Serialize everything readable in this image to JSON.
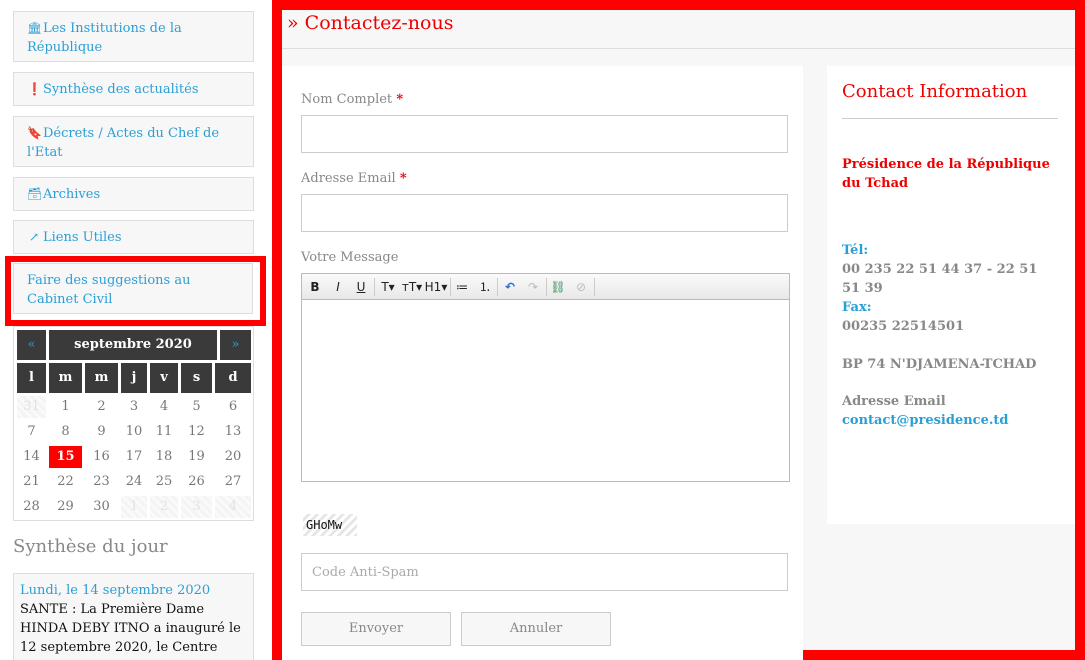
{
  "sidebar": {
    "nav": [
      {
        "icon": "institution-icon",
        "label": "Les Institutions de la République"
      },
      {
        "icon": "exclamation-circle-icon",
        "label": "Synthèse des actualités"
      },
      {
        "icon": "bookmark-icon",
        "label": "Décrets / Actes du Chef de l'Etat"
      },
      {
        "icon": "archive-icon",
        "label": "Archives"
      },
      {
        "icon": "external-link-icon",
        "label": "Liens Utiles"
      },
      {
        "icon": "",
        "label": "Faire des suggestions au Cabinet Civil"
      }
    ],
    "calendar": {
      "prev": "«",
      "next": "»",
      "title": "septembre 2020",
      "weekdays": [
        "l",
        "m",
        "m",
        "j",
        "v",
        "s",
        "d"
      ],
      "weeks": [
        [
          "31",
          "1",
          "2",
          "3",
          "4",
          "5",
          "6"
        ],
        [
          "7",
          "8",
          "9",
          "10",
          "11",
          "12",
          "13"
        ],
        [
          "14",
          "15",
          "16",
          "17",
          "18",
          "19",
          "20"
        ],
        [
          "21",
          "22",
          "23",
          "24",
          "25",
          "26",
          "27"
        ],
        [
          "28",
          "29",
          "30",
          "1",
          "2",
          "3",
          "4"
        ]
      ],
      "today": "15"
    },
    "synthese": {
      "title": "Synthèse du jour",
      "date": "Lundi, le 14 septembre 2020",
      "text": "SANTE : La Première Dame HINDA DEBY ITNO a  inauguré le 12 septembre 2020, le Centre national de lutte contre le cancer"
    }
  },
  "main": {
    "title": "» Contactez-nous",
    "form": {
      "name_label": "Nom Complet",
      "email_label": "Adresse Email",
      "required_mark": "*",
      "message_label": "Votre Message",
      "toolbar": [
        "B",
        "I",
        "U",
        "T▾",
        "тT▾",
        "H1▾",
        "≔",
        "⒈",
        "↶",
        "↷",
        "⛓",
        "⊘"
      ],
      "captcha": "GHoMw",
      "antispam_placeholder": "Code Anti-Spam",
      "submit_label": "Envoyer",
      "cancel_label": "Annuler"
    },
    "contact": {
      "title": "Contact Information",
      "org": "Présidence de la République du Tchad",
      "tel_label": "Tél:",
      "tel_value": "00 235 22 51 44 37 - 22 51 51 39",
      "fax_label": "Fax:",
      "fax_value": "00235 22514501",
      "address": "BP 74 N'DJAMENA-TCHAD",
      "email_label": "Adresse Email",
      "email_value": "contact@presidence.td"
    }
  }
}
